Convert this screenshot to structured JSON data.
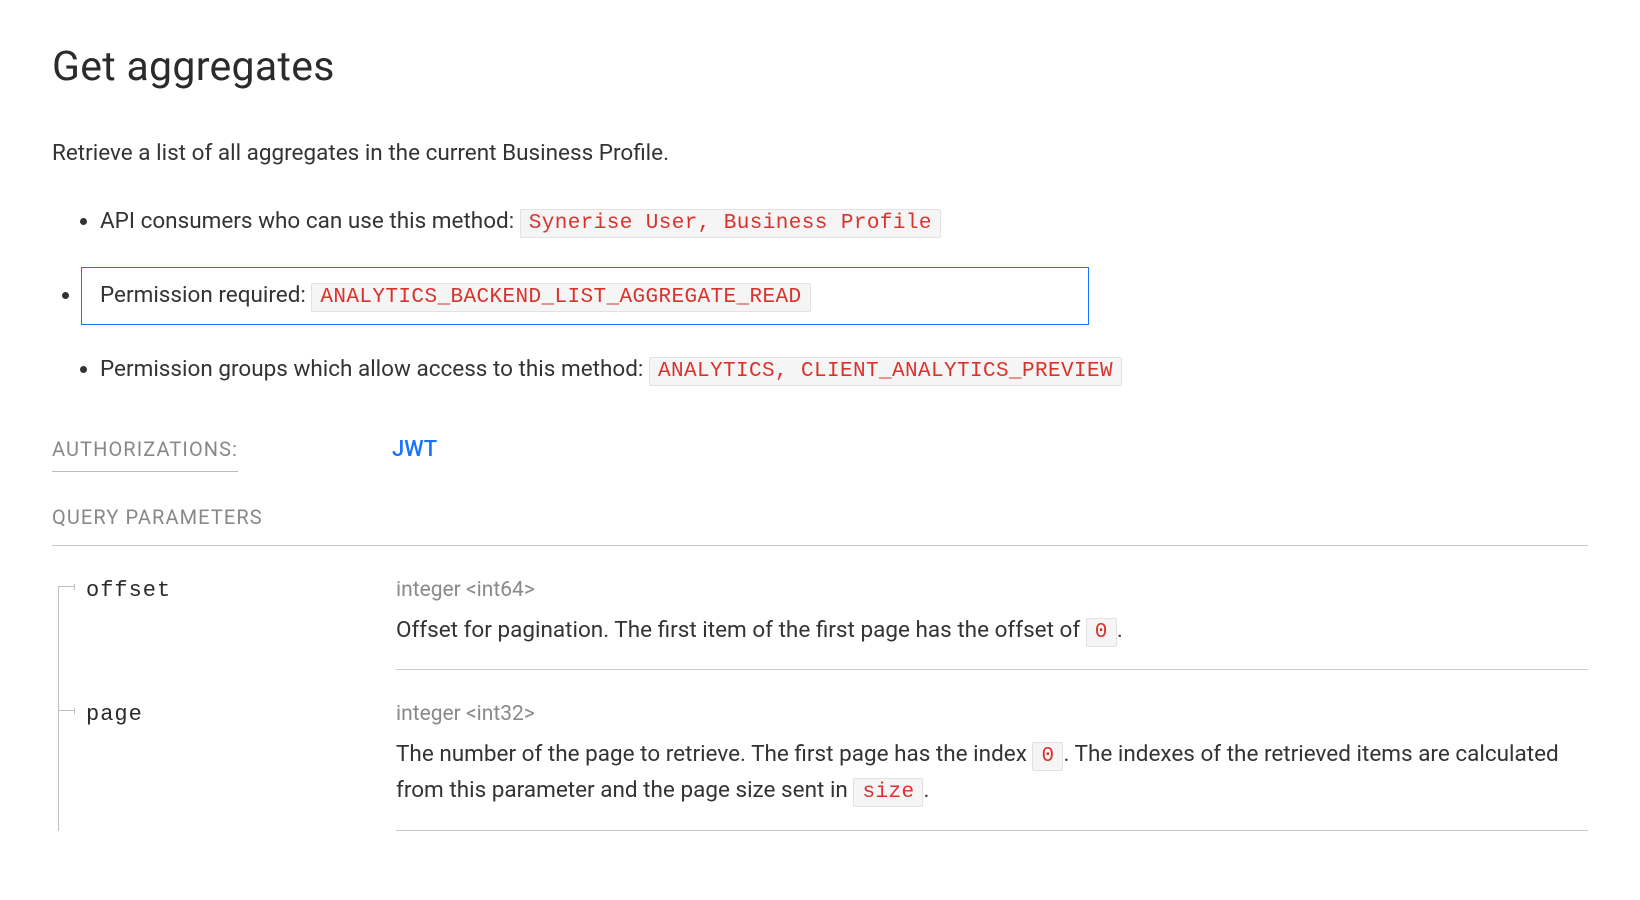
{
  "title": "Get aggregates",
  "intro": "Retrieve a list of all aggregates in the current Business Profile.",
  "info_list": [
    {
      "label": "API consumers who can use this method: ",
      "code": "Synerise User, Business Profile",
      "highlight": false
    },
    {
      "label": "Permission required: ",
      "code": "ANALYTICS_BACKEND_LIST_AGGREGATE_READ",
      "highlight": true
    },
    {
      "label": "Permission groups which allow access to this method: ",
      "code": "ANALYTICS, CLIENT_ANALYTICS_PREVIEW",
      "highlight": false
    }
  ],
  "authorizations": {
    "label": "AUTHORIZATIONS:",
    "value": "JWT"
  },
  "query_heading": "QUERY PARAMETERS",
  "params": [
    {
      "name": "offset",
      "type": "integer <int64>",
      "desc_pre": "Offset for pagination. The first item of the first page has the offset of ",
      "code1": "0",
      "desc_post": "."
    },
    {
      "name": "page",
      "type": "integer <int32>",
      "desc_pre": "The number of the page to retrieve. The first page has the index ",
      "code1": "0",
      "desc_mid": ". The indexes of the retrieved items are calculated from this parameter and the page size sent in ",
      "code2": "size",
      "desc_post": "."
    }
  ]
}
